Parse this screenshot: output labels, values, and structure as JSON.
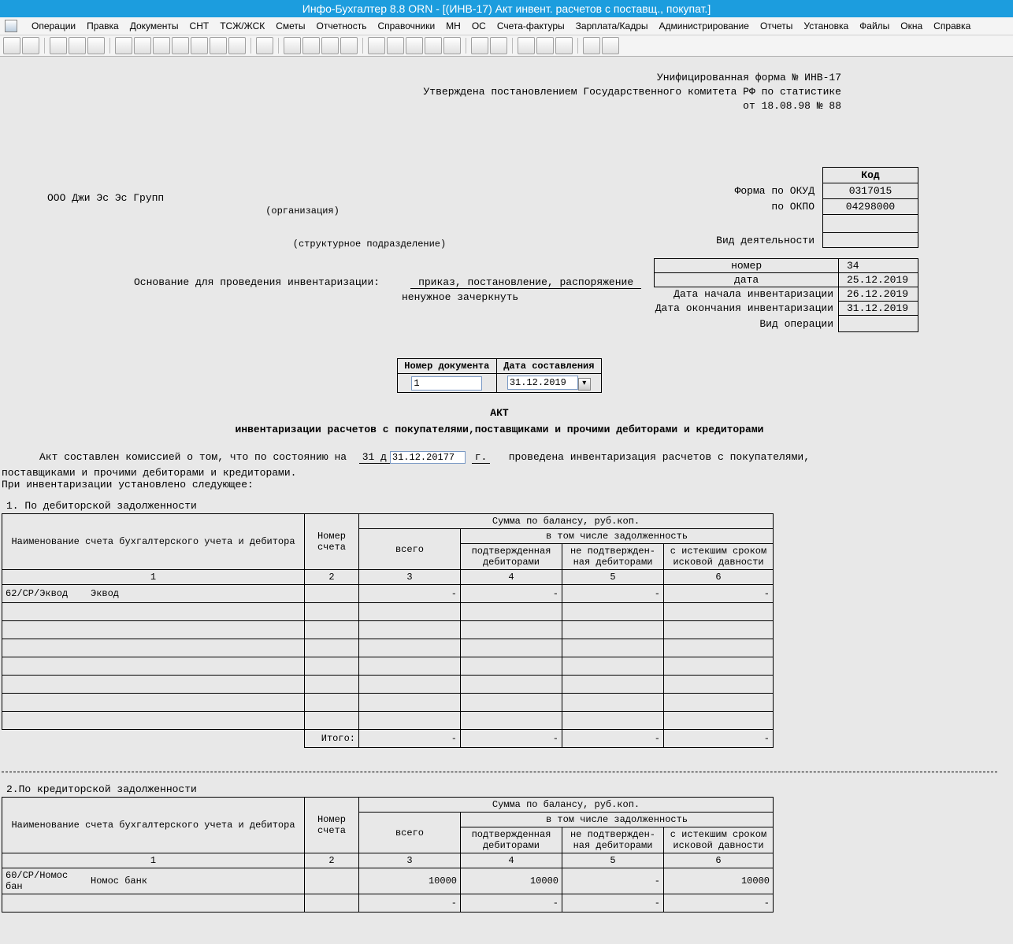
{
  "app": {
    "title": "Инфо-Бухгалтер 8.8   ORN   - [(ИНВ-17) Акт инвент. расчетов с поставщ., покупат.]"
  },
  "menu": {
    "items": [
      "Операции",
      "Правка",
      "Документы",
      "СНТ",
      "ТСЖ/ЖСК",
      "Сметы",
      "Отчетность",
      "Справочники",
      "МН",
      "ОС",
      "Счета-фактуры",
      "Зарплата/Кадры",
      "Администрирование",
      "Отчеты",
      "Установка",
      "Файлы",
      "Окна",
      "Справка"
    ]
  },
  "header": {
    "form_line": "Унифицированная форма № ИНВ-17",
    "approved_line": "Утверждена постановлением Государственного комитета РФ по статистике",
    "date_line": "от 18.08.98 № 88"
  },
  "codes": {
    "kod_label": "Код",
    "okud_label": "Форма по ОКУД",
    "okud": "0317015",
    "okpo_label": "по ОКПО",
    "okpo": "04298000",
    "vid_deyat_label": "Вид деятельности",
    "vid_deyat": "",
    "nomer_label": "номер",
    "nomer": "34",
    "data_label": "дата",
    "data": "25.12.2019",
    "start_label": "Дата начала инвентаризации",
    "start": "26.12.2019",
    "end_label": "Дата окончания инвентаризации",
    "end": "31.12.2019",
    "oper_label": "Вид операции",
    "oper": ""
  },
  "org": {
    "name": "ООО Джи Эс Эс Групп",
    "org_under": "(организация)",
    "unit_under": "(структурное подразделение)"
  },
  "basis": {
    "label": "Основание для проведения инвентаризации:",
    "value": "приказ, постановление, распоряжение",
    "strike": "ненужное зачеркнуть"
  },
  "docnum": {
    "num_label": "Номер документа",
    "date_label": "Дата составления",
    "num": "1",
    "date": "31.12.2019"
  },
  "akt": {
    "title": "АКТ",
    "subtitle": "инвентаризации расчетов с покупателями,поставщиками и прочими дебиторами и кредиторами",
    "body_prefix": "Акт составлен комиссией о том, что по состоянию на",
    "body_day": "31 д",
    "body_date": "31.12.20177",
    "body_g": "г.",
    "body_suffix": "проведена инвентаризация расчетов с покупателями,",
    "body_line2": "поставщиками и прочими дебиторами и кредиторами.",
    "body_line3": "При инвентаризации установлено следующее:"
  },
  "sect1": {
    "title": "1. По дебиторской задолженности",
    "headers": {
      "name": "Наименование счета бухгалтерского учета и дебитора",
      "acct": "Номер счета",
      "balance": "Сумма по балансу, руб.коп.",
      "total": "всего",
      "sub": "в том числе задолженность",
      "confirmed": "подтвержденная дебиторами",
      "unconfirmed": "не подтвержден- ная дебиторами",
      "expired": "с истекшим сроком исковой давности"
    },
    "colnums": [
      "1",
      "2",
      "3",
      "4",
      "5",
      "6"
    ],
    "rows": [
      {
        "code": "62/СР/Эквод",
        "name": "Эквод",
        "acct": "",
        "total": "-",
        "c": "-",
        "u": "-",
        "e": "-"
      },
      {
        "code": "",
        "name": "",
        "acct": "",
        "total": "",
        "c": "",
        "u": "",
        "e": ""
      },
      {
        "code": "",
        "name": "",
        "acct": "",
        "total": "",
        "c": "",
        "u": "",
        "e": ""
      },
      {
        "code": "",
        "name": "",
        "acct": "",
        "total": "",
        "c": "",
        "u": "",
        "e": ""
      },
      {
        "code": "",
        "name": "",
        "acct": "",
        "total": "",
        "c": "",
        "u": "",
        "e": ""
      },
      {
        "code": "",
        "name": "",
        "acct": "",
        "total": "",
        "c": "",
        "u": "",
        "e": ""
      },
      {
        "code": "",
        "name": "",
        "acct": "",
        "total": "",
        "c": "",
        "u": "",
        "e": ""
      },
      {
        "code": "",
        "name": "",
        "acct": "",
        "total": "",
        "c": "",
        "u": "",
        "e": ""
      }
    ],
    "itogo_label": "Итого:",
    "itogo": {
      "total": "-",
      "c": "-",
      "u": "-",
      "e": "-"
    }
  },
  "sect2": {
    "title": "2.По кредиторской задолженности",
    "rows": [
      {
        "code": "60/СР/Номос бан",
        "name": "Номос банк",
        "acct": "",
        "total": "10000",
        "c": "10000",
        "u": "-",
        "e": "10000"
      },
      {
        "code": "",
        "name": "",
        "acct": "",
        "total": "-",
        "c": "-",
        "u": "-",
        "e": "-"
      }
    ]
  }
}
